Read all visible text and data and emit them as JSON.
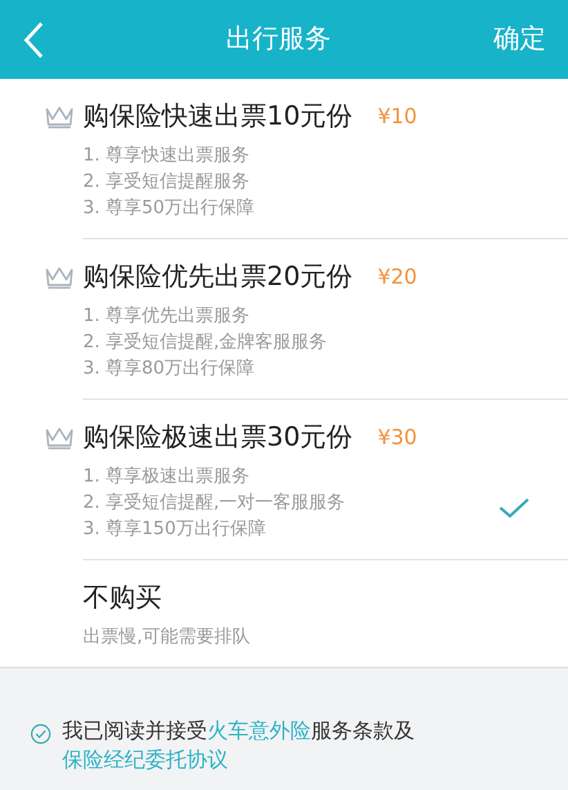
{
  "header": {
    "title": "出行服务",
    "confirm": "确定"
  },
  "options": [
    {
      "kind": "insurance",
      "title": "购保险快速出票10元份",
      "price": "¥10",
      "selected": false,
      "details": [
        "1. 尊享快速出票服务",
        "2. 享受短信提醒服务",
        "3. 尊享50万出行保障"
      ]
    },
    {
      "kind": "insurance",
      "title": "购保险优先出票20元份",
      "price": "¥20",
      "selected": false,
      "details": [
        "1. 尊享优先出票服务",
        "2. 享受短信提醒,金牌客服服务",
        "3. 尊享80万出行保障"
      ]
    },
    {
      "kind": "insurance",
      "title": "购保险极速出票30元份",
      "price": "¥30",
      "selected": true,
      "details": [
        "1. 尊享极速出票服务",
        "2. 享受短信提醒,一对一客服服务",
        "3. 尊享150万出行保障"
      ]
    },
    {
      "kind": "none",
      "title": "不购买",
      "selected": false,
      "details": [
        "出票慢,可能需要排队"
      ]
    }
  ],
  "agreement": {
    "checked": true,
    "segments": [
      {
        "kind": "text",
        "text": "我已阅读并接受"
      },
      {
        "kind": "link",
        "text": "火车意外险"
      },
      {
        "kind": "text",
        "text": "服务条款及"
      },
      {
        "kind": "link",
        "text": "保险经纪委托协议"
      }
    ]
  }
}
